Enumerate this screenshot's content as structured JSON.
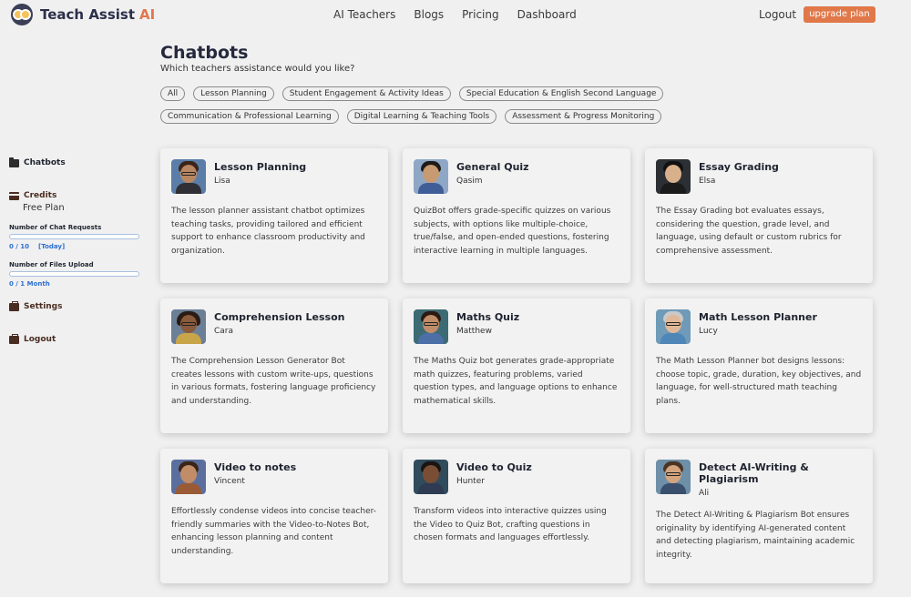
{
  "brand": {
    "name": "Teach Assist",
    "accent": "AI"
  },
  "nav": {
    "items": [
      "AI Teachers",
      "Blogs",
      "Pricing",
      "Dashboard"
    ],
    "logout": "Logout",
    "upgrade": "upgrade plan"
  },
  "sidebar": {
    "chatbots": "Chatbots",
    "credits": "Credits",
    "plan": "Free Plan",
    "chat_label": "Number of Chat Requests",
    "chat_used": "0 / 10",
    "chat_period": "[Today]",
    "chat_fraction": 0,
    "files_label": "Number of Files Upload",
    "files_used": "0 / 1 Month",
    "files_fraction": 0,
    "settings": "Settings",
    "logout": "Logout"
  },
  "main": {
    "title": "Chatbots",
    "subtitle": "Which teachers assistance would you like?",
    "filters": [
      "All",
      "Lesson Planning",
      "Student Engagement & Activity Ideas",
      "Special Education & English Second Language",
      "Communication & Professional Learning",
      "Digital Learning & Teaching Tools",
      "Assessment & Progress Monitoring"
    ],
    "cards": [
      {
        "title": "Lesson Planning",
        "name": "Lisa",
        "desc": "The lesson planner assistant chatbot optimizes teaching tasks, providing tailored and efficient support to enhance classroom productivity and organization."
      },
      {
        "title": "General Quiz",
        "name": "Qasim",
        "desc": "QuizBot offers grade-specific quizzes on various subjects, with options like multiple-choice, true/false, and open-ended questions, fostering interactive learning in multiple languages."
      },
      {
        "title": "Essay Grading",
        "name": "Elsa",
        "desc": "The Essay Grading bot evaluates essays, considering the question, grade level, and language, using default or custom rubrics for comprehensive assessment."
      },
      {
        "title": "Comprehension Lesson",
        "name": "Cara",
        "desc": "The Comprehension Lesson Generator Bot creates lessons with custom write-ups, questions in various formats, fostering language proficiency and understanding."
      },
      {
        "title": "Maths Quiz",
        "name": "Matthew",
        "desc": "The Maths Quiz bot generates grade-appropriate math quizzes, featuring problems, varied question types, and language options to enhance mathematical skills."
      },
      {
        "title": "Math Lesson Planner",
        "name": "Lucy",
        "desc": "The Math Lesson Planner bot designs lessons: choose topic, grade, duration, key objectives, and language, for well-structured math teaching plans."
      },
      {
        "title": "Video to notes",
        "name": "Vincent",
        "desc": "Effortlessly condense videos into concise teacher-friendly summaries with the Video-to-Notes Bot, enhancing lesson planning and content understanding."
      },
      {
        "title": "Video to Quiz",
        "name": "Hunter",
        "desc": "Transform videos into interactive quizzes using the Video to Quiz Bot, crafting questions in chosen formats and languages effortlessly."
      },
      {
        "title": "Detect AI-Writing & Plagiarism",
        "name": "Ali",
        "desc": "The Detect AI-Writing & Plagiarism Bot ensures originality by identifying AI-generated content and detecting plagiarism, maintaining academic integrity."
      }
    ]
  },
  "colors": {
    "accent": "#e0784a",
    "brand": "#2b2f4a",
    "meter": "#4f86d6",
    "sidebar_brown": "#4a2d22"
  }
}
